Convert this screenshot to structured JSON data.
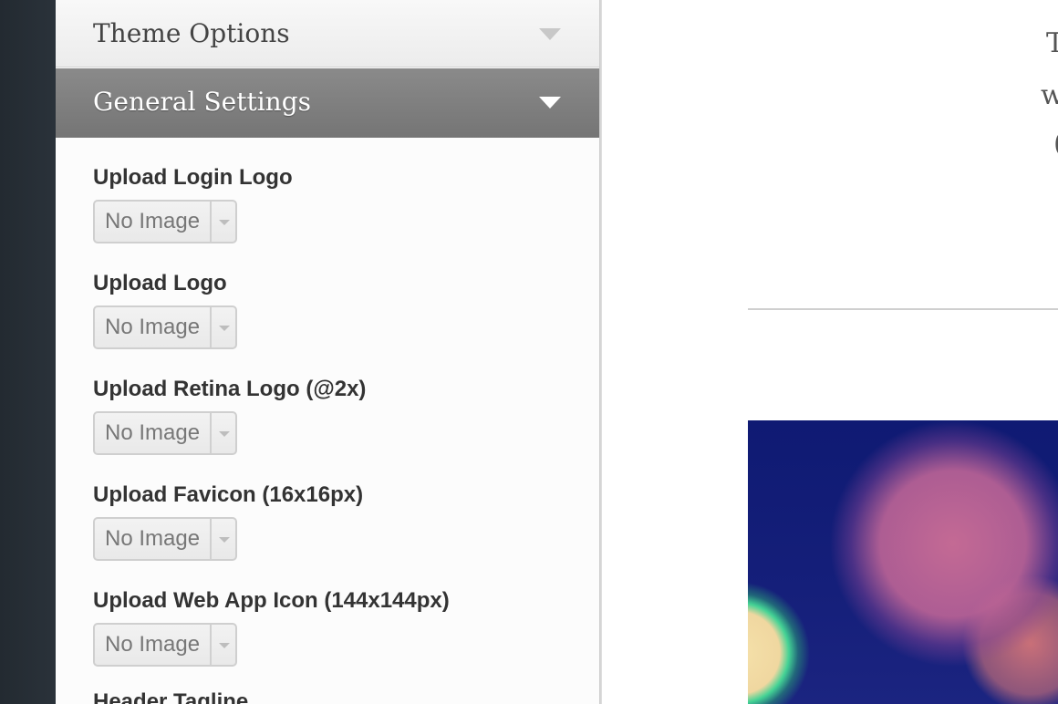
{
  "sidebar": {
    "theme_options_header": "Theme Options",
    "general_settings_header": "General Settings",
    "fields": [
      {
        "label": "Upload Login Logo",
        "value": "No Image"
      },
      {
        "label": "Upload Logo",
        "value": "No Image"
      },
      {
        "label": "Upload Retina Logo (@2x)",
        "value": "No Image"
      },
      {
        "label": "Upload Favicon (16x16px)",
        "value": "No Image"
      },
      {
        "label": "Upload Web App Icon (144x144px)",
        "value": "No Image"
      }
    ],
    "next_field_label": "Header Tagline"
  },
  "preview": {
    "text_line_1": "T",
    "text_line_2": "w",
    "text_line_3": "("
  },
  "icons": {
    "section_toggle": "triangle-down",
    "select_dropdown": "chevron-down"
  },
  "colors": {
    "active_header_bg": "#7f7f7f",
    "panel_bg": "#fcfcfc",
    "rail_bg": "#272e35"
  }
}
